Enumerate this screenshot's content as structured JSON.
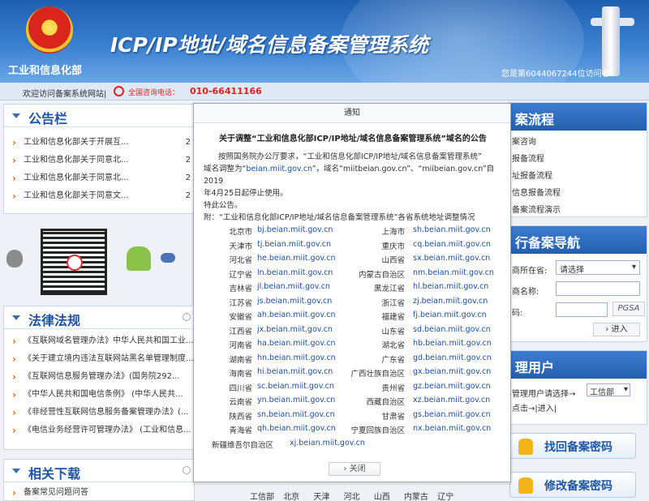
{
  "header": {
    "title": "ICP/IP地址/域名信息备案管理系统",
    "ministry": "工业和信息化部",
    "visitors": "您是第6044067244位访问者"
  },
  "subbar": {
    "welcome": "欢迎访问备案系统网站|",
    "phone_label": "全国咨询电话：",
    "phone": "010-66411166"
  },
  "announce": {
    "title": "公告栏",
    "items": [
      {
        "text": "工业和信息化部关于开展互...",
        "date": "2"
      },
      {
        "text": "工业和信息化部关于同意北...",
        "date": "2"
      },
      {
        "text": "工业和信息化部关于同意北...",
        "date": "2"
      },
      {
        "text": "工业和信息化部关于同意文...",
        "date": "2"
      }
    ]
  },
  "laws": {
    "title": "法律法规",
    "items": [
      "《互联网域名管理办法》中华人民共和国工业...",
      "《关于建立境内违法互联网站黑名单管理制度...",
      "《互联网信息服务管理办法》(国务院292...",
      "《中华人民共和国电信条例》 (中华人民共...",
      "《非经营性互联网信息服务备案管理办法》(...",
      "《电信业务经营许可管理办法》 (工业和信息..."
    ]
  },
  "downloads": {
    "title": "相关下载",
    "items": [
      "备案常见问题问答"
    ]
  },
  "footer_provinces": [
    "工信部",
    "北京",
    "天津",
    "河北",
    "山西",
    "内蒙古",
    "辽宁"
  ],
  "right": {
    "flow_title": "案流程",
    "flow_items": [
      "案咨询",
      "报备流程",
      "址报备流程",
      "信息报备流程",
      "备案流程演示"
    ],
    "nav_title": "行备案导航",
    "province_label": "商所在省:",
    "province_value": "请选择",
    "name_label": "商名称:",
    "code_label": "码:",
    "captcha": "PGSA",
    "enter_label": "进入",
    "manage_title": "理用户",
    "manage_text": "管理用户请选择→",
    "manage_select": "工信部",
    "manage_click": "点击→",
    "manage_enter": "进入",
    "btn_recover": "找回备案密码",
    "btn_modify": "修改备案密码"
  },
  "modal": {
    "title": "通知",
    "heading": "关于调整“工业和信息化部ICP/IP地址/域名信息备案管理系统”域名的公告",
    "para1": "按照国务院办公厅要求，“工业和信息化部ICP/IP地址/域名信息备案管理系统”",
    "para2_a": "域名调整为“",
    "para2_b": "beian.miit.gov.cn",
    "para2_c": "”，域名“miitbeian.gov.cn”、“miibeian.gov.cn”自2019",
    "para3": "年4月25日起停止使用。",
    "para4": "特此公告。",
    "para5": "附：“工业和信息化部ICP/IP地址/域名信息备案管理系统”各省系统地址调整情况",
    "rows": [
      {
        "p1": "北京市",
        "u1": "bj.beian.miit.gov.cn",
        "p2": "上海市",
        "u2": "sh.beian.miit.gov.cn"
      },
      {
        "p1": "天津市",
        "u1": "tj.beian.miit.gov.cn",
        "p2": "重庆市",
        "u2": "cq.beian.miit.gov.cn"
      },
      {
        "p1": "河北省",
        "u1": "he.beian.miit.gov.cn",
        "p2": "山西省",
        "u2": "sx.beian.miit.gov.cn"
      },
      {
        "p1": "辽宁省",
        "u1": "ln.beian.miit.gov.cn",
        "p2": "内蒙古自治区",
        "u2": "nm.beian.miit.gov.cn"
      },
      {
        "p1": "吉林省",
        "u1": "jl.beian.miit.gov.cn",
        "p2": "黑龙江省",
        "u2": "hl.beian.miit.gov.cn"
      },
      {
        "p1": "江苏省",
        "u1": "js.beian.miit.gov.cn",
        "p2": "浙江省",
        "u2": "zj.beian.miit.gov.cn"
      },
      {
        "p1": "安徽省",
        "u1": "ah.beian.miit.gov.cn",
        "p2": "福建省",
        "u2": "fj.beian.miit.gov.cn"
      },
      {
        "p1": "江西省",
        "u1": "jx.beian.miit.gov.cn",
        "p2": "山东省",
        "u2": "sd.beian.miit.gov.cn"
      },
      {
        "p1": "河南省",
        "u1": "ha.beian.miit.gov.cn",
        "p2": "湖北省",
        "u2": "hb.beian.miit.gov.cn"
      },
      {
        "p1": "湖南省",
        "u1": "hn.beian.miit.gov.cn",
        "p2": "广东省",
        "u2": "gd.beian.miit.gov.cn"
      },
      {
        "p1": "海南省",
        "u1": "hi.beian.miit.gov.cn",
        "p2": "广西壮族自治区",
        "u2": "gx.beian.miit.gov.cn"
      },
      {
        "p1": "四川省",
        "u1": "sc.beian.miit.gov.cn",
        "p2": "贵州省",
        "u2": "gz.beian.miit.gov.cn"
      },
      {
        "p1": "云南省",
        "u1": "yn.beian.miit.gov.cn",
        "p2": "西藏自治区",
        "u2": "xz.beian.miit.gov.cn"
      },
      {
        "p1": "陕西省",
        "u1": "sn.beian.miit.gov.cn",
        "p2": "甘肃省",
        "u2": "gs.beian.miit.gov.cn"
      },
      {
        "p1": "青海省",
        "u1": "qh.beian.miit.gov.cn",
        "p2": "宁夏回族自治区",
        "u2": "nx.beian.miit.gov.cn"
      },
      {
        "p1": "新疆维吾尔自治区",
        "u1": "xj.beian.miit.gov.cn",
        "p2": "",
        "u2": ""
      }
    ],
    "close_label": "关闭"
  }
}
